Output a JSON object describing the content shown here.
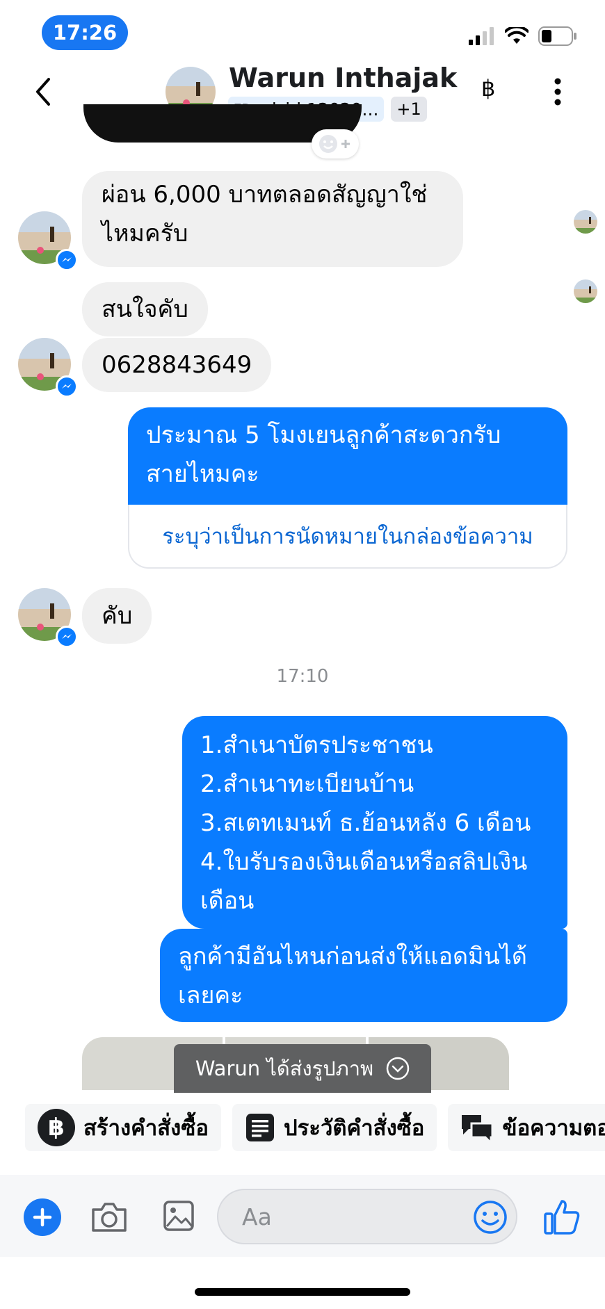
{
  "status_bar": {
    "time": "17:26"
  },
  "header": {
    "name": "Warun Inthajak",
    "fb_tag": "FB",
    "ad_chip": "ad_id.12020...",
    "extra_count": "+1",
    "baht_symbol": "฿"
  },
  "messages": [
    {
      "from": "contact",
      "text": "ผ่อน 6,000 บาทตลอดสัญญาใช่\nไหมครับ"
    },
    {
      "from": "contact",
      "text": "สนใจคับ"
    },
    {
      "from": "contact",
      "text": "0628843649"
    },
    {
      "from": "me",
      "text": "ประมาณ 5 โมงเยนลูกค้าสะดวกรับ\nสายไหมคะ",
      "card": "ระบุว่าเป็นการนัดหมายในกล่องข้อความ"
    },
    {
      "from": "contact",
      "text": "คับ"
    },
    {
      "from": "me",
      "text": "1.สำเนาบัตรประชาชน\n2.สำเนาทะเบียนบ้าน\n3.สเตทเมนท์ ธ.ย้อนหลัง 6 เดือน\n4.ใบรับรองเงินเดือนหรือสลิปเงิน\nเดือน"
    },
    {
      "from": "me",
      "text": "ลูกค้ามีอันไหนก่อนส่งให้แอดมินได้\nเลยคะ"
    }
  ],
  "timestamp": "17:10",
  "toast": {
    "text": "Warun ได้ส่งรูปภาพ"
  },
  "quick_actions": [
    {
      "label": "สร้างคำสั่งซื้อ",
      "icon": "baht-icon"
    },
    {
      "label": "ประวัติคำสั่งซื้อ",
      "icon": "receipt-icon"
    },
    {
      "label": "ข้อความตอ",
      "icon": "chat-bubbles-icon"
    }
  ],
  "composer": {
    "placeholder": "Aa"
  },
  "colors": {
    "accent": "#0a7cff",
    "brand": "#1877f2",
    "incoming_bg": "#f0f0f0"
  }
}
